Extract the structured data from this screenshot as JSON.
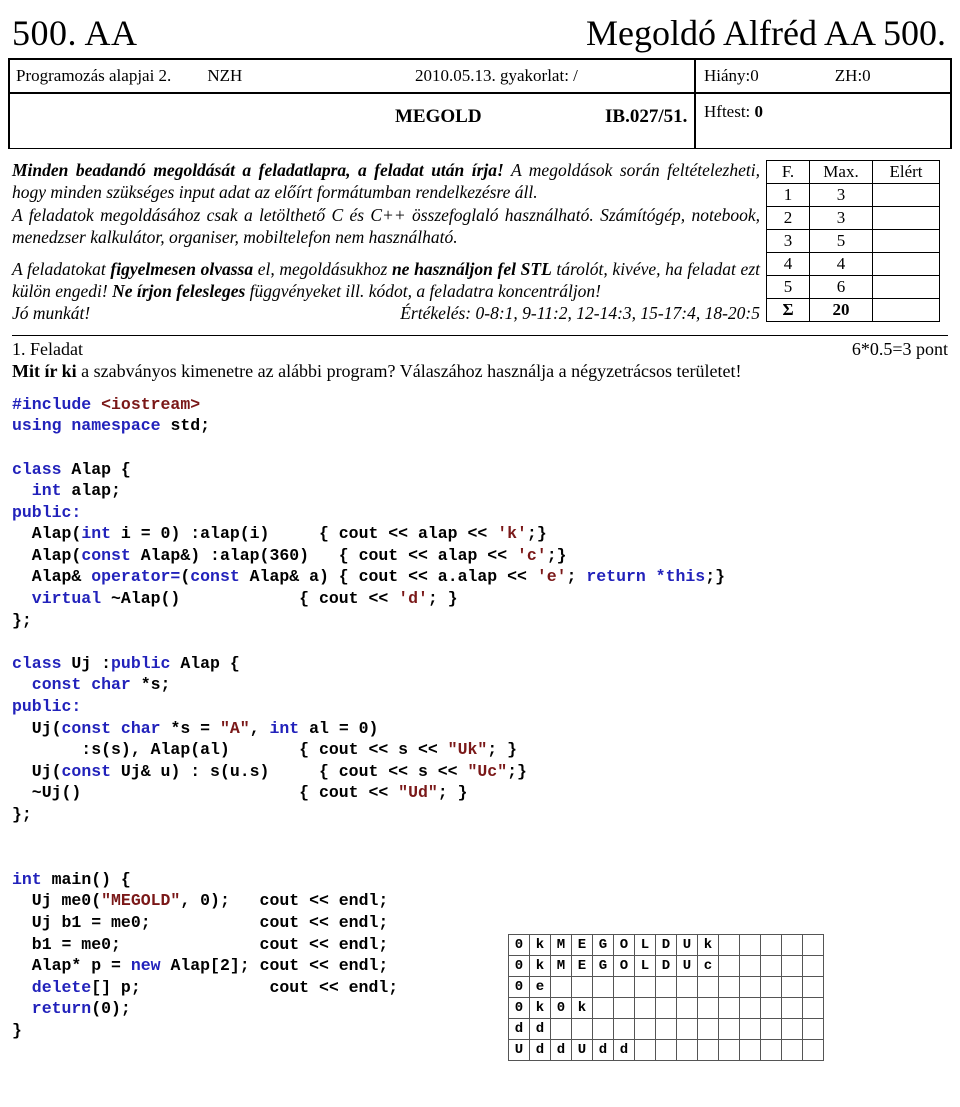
{
  "title": {
    "left": "500. AA",
    "right": "Megoldó Alfréd AA 500."
  },
  "header": {
    "course": "Programozás alapjai 2.",
    "exam_type": "NZH",
    "date_line": "2010.05.13. gyakorlat: /",
    "hiany": "Hiány:0",
    "zh": "ZH:0",
    "solution_label": "MEGOLD",
    "code": "IB.027/51.",
    "hftest_label": "Hftest:",
    "hftest_value": "0"
  },
  "instructions": {
    "line1_bold": "Minden beadandó megoldását a feladatlapra, a feladat után írja!",
    "line1_rest": " A megoldások során feltételezheti, hogy minden szükséges input adat az előírt formátumban rendelkezésre áll.",
    "line2": "A feladatok megoldásához csak a letölthető C és C++ összefoglaló használható. Számítógép, notebook, menedzser kalkulátor, organiser, mobiltelefon nem használható.",
    "line3_a": "A feladatokat ",
    "line3_b_bold": "figyelmesen olvassa",
    "line3_c": " el, megoldásukhoz ",
    "line3_d_bold": "ne használjon fel STL",
    "line3_e": " tárolót, kivéve, ha feladat ezt külön engedi! ",
    "line3_f_bold": "Ne írjon felesleges",
    "line3_g": " függvényeket ill. kódot, a feladatra koncentráljon!",
    "jo_munkat": "Jó munkát!",
    "ertekeles": "Értékelés: 0-8:1, 9-11:2, 12-14:3, 15-17:4, 18-20:5"
  },
  "score_table": {
    "headers": [
      "F.",
      "Max.",
      "Elért"
    ],
    "rows": [
      {
        "f": "1",
        "max": "3",
        "elert": ""
      },
      {
        "f": "2",
        "max": "3",
        "elert": ""
      },
      {
        "f": "3",
        "max": "5",
        "elert": ""
      },
      {
        "f": "4",
        "max": "4",
        "elert": ""
      },
      {
        "f": "5",
        "max": "6",
        "elert": ""
      }
    ],
    "sum": {
      "f": "Σ",
      "max": "20",
      "elert": ""
    }
  },
  "task": {
    "number_label": "1. Feladat",
    "points": "6*0.5=3 pont",
    "question_bold": "Mit ír ki",
    "question_rest": " a szabványos kimenetre az alábbi program? Válaszához használja a négyzetrácsos területet!"
  },
  "answer_grid": {
    "cols": 15,
    "rows": [
      [
        "0",
        "k",
        "M",
        "E",
        "G",
        "O",
        "L",
        "D",
        "U",
        "k",
        "",
        "",
        "",
        "",
        ""
      ],
      [
        "0",
        "k",
        "M",
        "E",
        "G",
        "O",
        "L",
        "D",
        "U",
        "c",
        "",
        "",
        "",
        "",
        ""
      ],
      [
        "0",
        "e",
        "",
        "",
        "",
        "",
        "",
        "",
        "",
        "",
        "",
        "",
        "",
        "",
        ""
      ],
      [
        "0",
        "k",
        "0",
        "k",
        "",
        "",
        "",
        "",
        "",
        "",
        "",
        "",
        "",
        "",
        ""
      ],
      [
        "d",
        "d",
        "",
        "",
        "",
        "",
        "",
        "",
        "",
        "",
        "",
        "",
        "",
        "",
        ""
      ],
      [
        "U",
        "d",
        "d",
        "U",
        "d",
        "d",
        "",
        "",
        "",
        "",
        "",
        "",
        "",
        "",
        ""
      ]
    ]
  },
  "code": {
    "colors": {
      "keyword": "#2222bb",
      "string": "#7a1818",
      "plain": "#000000"
    },
    "lines": [
      [
        {
          "t": "#include ",
          "c": "kw"
        },
        {
          "t": "<iostream>",
          "c": "str"
        }
      ],
      [
        {
          "t": "using namespace ",
          "c": "kw"
        },
        {
          "t": "std;",
          "c": "plain"
        }
      ],
      [],
      [
        {
          "t": "class ",
          "c": "kw"
        },
        {
          "t": "Alap {",
          "c": "plain"
        }
      ],
      [
        {
          "t": "  int ",
          "c": "kw"
        },
        {
          "t": "alap;",
          "c": "plain"
        }
      ],
      [
        {
          "t": "public:",
          "c": "kw"
        }
      ],
      [
        {
          "t": "  Alap(",
          "c": "plain"
        },
        {
          "t": "int",
          "c": "kw"
        },
        {
          "t": " i = 0) :alap(i)     { cout << alap << ",
          "c": "plain"
        },
        {
          "t": "'k'",
          "c": "str"
        },
        {
          "t": ";}",
          "c": "plain"
        }
      ],
      [
        {
          "t": "  Alap(",
          "c": "plain"
        },
        {
          "t": "const",
          "c": "kw"
        },
        {
          "t": " Alap&) :alap(360)   { cout << alap << ",
          "c": "plain"
        },
        {
          "t": "'c'",
          "c": "str"
        },
        {
          "t": ";}",
          "c": "plain"
        }
      ],
      [
        {
          "t": "  Alap& ",
          "c": "plain"
        },
        {
          "t": "operator=",
          "c": "kw"
        },
        {
          "t": "(",
          "c": "plain"
        },
        {
          "t": "const",
          "c": "kw"
        },
        {
          "t": " Alap& a) { cout << a.alap << ",
          "c": "plain"
        },
        {
          "t": "'e'",
          "c": "str"
        },
        {
          "t": "; ",
          "c": "plain"
        },
        {
          "t": "return *this",
          "c": "kw"
        },
        {
          "t": ";}",
          "c": "plain"
        }
      ],
      [
        {
          "t": "  virtual",
          "c": "kw"
        },
        {
          "t": " ~Alap()            { cout << ",
          "c": "plain"
        },
        {
          "t": "'d'",
          "c": "str"
        },
        {
          "t": "; }",
          "c": "plain"
        }
      ],
      [
        {
          "t": "};",
          "c": "plain"
        }
      ],
      [],
      [
        {
          "t": "class ",
          "c": "kw"
        },
        {
          "t": "Uj :",
          "c": "plain"
        },
        {
          "t": "public",
          "c": "kw"
        },
        {
          "t": " Alap {",
          "c": "plain"
        }
      ],
      [
        {
          "t": "  const char",
          "c": "kw"
        },
        {
          "t": " *s;",
          "c": "plain"
        }
      ],
      [
        {
          "t": "public:",
          "c": "kw"
        }
      ],
      [
        {
          "t": "  Uj(",
          "c": "plain"
        },
        {
          "t": "const char",
          "c": "kw"
        },
        {
          "t": " *s = ",
          "c": "plain"
        },
        {
          "t": "\"A\"",
          "c": "str"
        },
        {
          "t": ", ",
          "c": "plain"
        },
        {
          "t": "int",
          "c": "kw"
        },
        {
          "t": " al = 0)",
          "c": "plain"
        }
      ],
      [
        {
          "t": "       :s(s), Alap(al)       { cout << s << ",
          "c": "plain"
        },
        {
          "t": "\"Uk\"",
          "c": "str"
        },
        {
          "t": "; }",
          "c": "plain"
        }
      ],
      [
        {
          "t": "  Uj(",
          "c": "plain"
        },
        {
          "t": "const",
          "c": "kw"
        },
        {
          "t": " Uj& u) : s(u.s)     { cout << s << ",
          "c": "plain"
        },
        {
          "t": "\"Uc\"",
          "c": "str"
        },
        {
          "t": ";}",
          "c": "plain"
        }
      ],
      [
        {
          "t": "  ~Uj()                      { cout << ",
          "c": "plain"
        },
        {
          "t": "\"Ud\"",
          "c": "str"
        },
        {
          "t": "; }",
          "c": "plain"
        }
      ],
      [
        {
          "t": "};",
          "c": "plain"
        }
      ],
      [],
      [],
      [
        {
          "t": "int",
          "c": "kw"
        },
        {
          "t": " main() {",
          "c": "plain"
        }
      ],
      [
        {
          "t": "  Uj me0(",
          "c": "plain"
        },
        {
          "t": "\"MEGOLD\"",
          "c": "str"
        },
        {
          "t": ", 0);   cout << endl;",
          "c": "plain"
        }
      ],
      [
        {
          "t": "  Uj b1 = me0;           cout << endl;",
          "c": "plain"
        }
      ],
      [
        {
          "t": "  b1 = me0;              cout << endl;",
          "c": "plain"
        }
      ],
      [
        {
          "t": "  Alap* p = ",
          "c": "plain"
        },
        {
          "t": "new",
          "c": "kw"
        },
        {
          "t": " Alap[2]; cout << endl;",
          "c": "plain"
        }
      ],
      [
        {
          "t": "  delete",
          "c": "kw"
        },
        {
          "t": "[] p;             cout << endl;",
          "c": "plain"
        }
      ],
      [
        {
          "t": "  return",
          "c": "kw"
        },
        {
          "t": "(0);",
          "c": "plain"
        }
      ],
      [
        {
          "t": "}",
          "c": "plain"
        }
      ]
    ]
  }
}
